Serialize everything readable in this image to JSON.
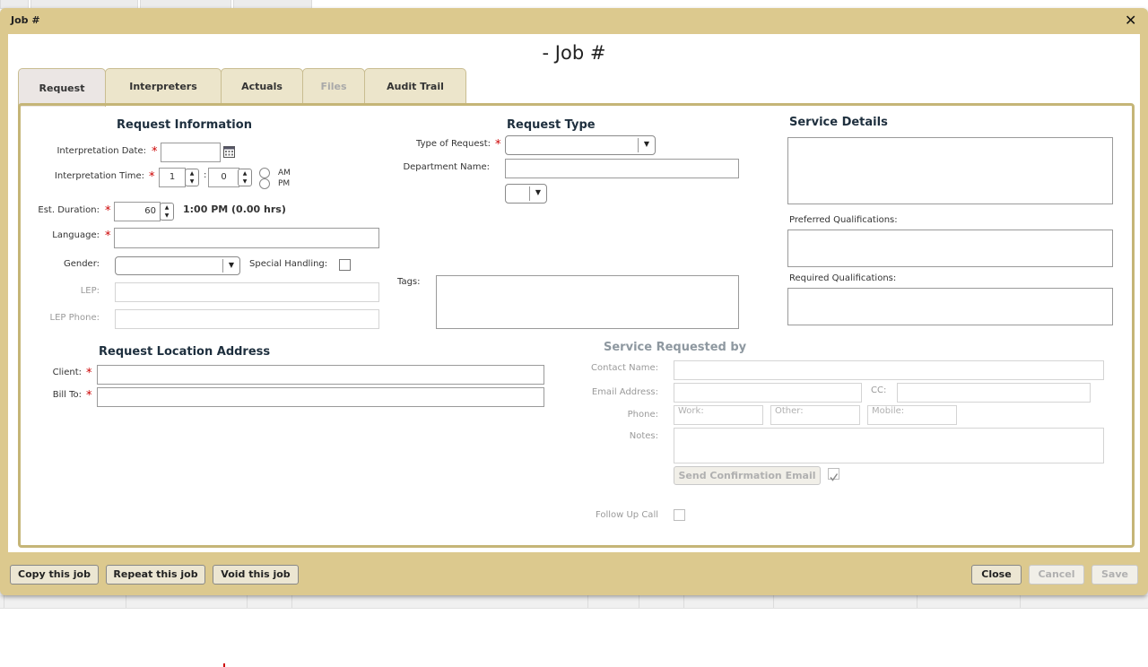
{
  "dialog": {
    "title": "Job #",
    "job_heading": "- Job #",
    "close_glyph": "✕"
  },
  "tabs": [
    {
      "label": "Request",
      "state": "active"
    },
    {
      "label": "Interpreters",
      "state": "normal"
    },
    {
      "label": "Actuals",
      "state": "normal"
    },
    {
      "label": "Files",
      "state": "disabled"
    },
    {
      "label": "Audit Trail",
      "state": "normal"
    }
  ],
  "required_marker": "*",
  "request_info": {
    "heading": "Request Information",
    "interpretation_date_label": "Interpretation Date:",
    "interpretation_date_value": "",
    "interpretation_time_label": "Interpretation Time:",
    "hour_value": "1",
    "time_sep": ":",
    "minute_value": "0",
    "am_label": "AM",
    "pm_label": "PM",
    "est_duration_label": "Est. Duration:",
    "duration_value": "60",
    "end_time_text": "1:00 PM (0.00 hrs)",
    "language_label": "Language:",
    "language_value": "",
    "gender_label": "Gender:",
    "gender_value": "",
    "special_handling_label": "Special Handling:",
    "special_handling_checked": false,
    "lep_label": "LEP:",
    "lep_value": "",
    "lep_phone_label": "LEP Phone:",
    "lep_phone_value": ""
  },
  "request_type": {
    "heading": "Request Type",
    "type_label": "Type of Request:",
    "type_value": "",
    "department_label": "Department Name:",
    "department_value": "",
    "extra_select_value": "",
    "tags_label": "Tags:",
    "tags_value": ""
  },
  "service_details": {
    "heading": "Service Details",
    "details_value": "",
    "preferred_label": "Preferred Qualifications:",
    "preferred_value": "",
    "required_label": "Required Qualifications:",
    "required_value": ""
  },
  "location": {
    "heading": "Request Location Address",
    "client_label": "Client:",
    "client_value": "",
    "bill_to_label": "Bill To:",
    "bill_to_value": ""
  },
  "requested_by": {
    "heading": "Service Requested by",
    "contact_label": "Contact Name:",
    "contact_value": "",
    "email_label": "Email Address:",
    "email_value": "",
    "cc_label": "CC:",
    "cc_value": "",
    "phone_label": "Phone:",
    "work_placeholder": "Work:",
    "other_placeholder": "Other:",
    "mobile_placeholder": "Mobile:",
    "notes_label": "Notes:",
    "notes_value": "",
    "send_email_label": "Send Confirmation Email",
    "send_email_checked": true,
    "follow_up_label": "Follow Up Call",
    "follow_up_checked": false
  },
  "footer": {
    "copy_label": "Copy this job",
    "repeat_label": "Repeat this job",
    "void_label": "Void this job",
    "close_label": "Close",
    "cancel_label": "Cancel",
    "save_label": "Save"
  },
  "colors": {
    "dialog_bg": "#dcc98e",
    "panel_border": "#c5b577",
    "required": "#cc0000",
    "heading": "#1e2f3e"
  }
}
